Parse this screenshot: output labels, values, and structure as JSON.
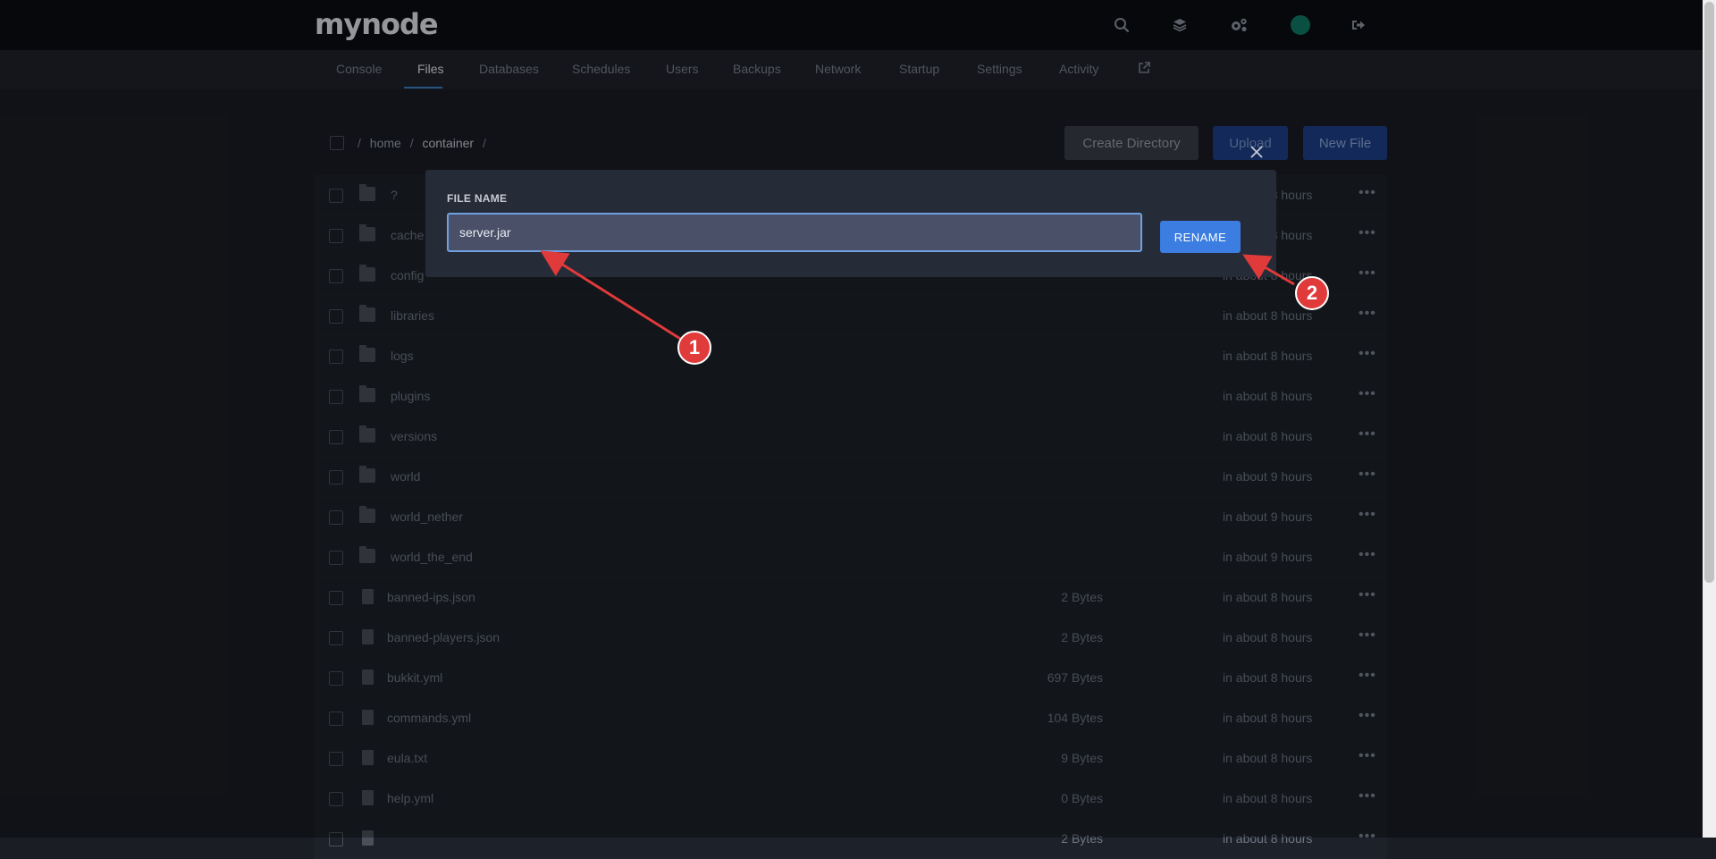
{
  "app": {
    "logo": "mynode"
  },
  "topbar": {
    "icons": [
      "search-icon",
      "layers-icon",
      "gears-icon",
      "avatar",
      "logout-icon"
    ]
  },
  "tabs": [
    "Console",
    "Files",
    "Databases",
    "Schedules",
    "Users",
    "Backups",
    "Network",
    "Startup",
    "Settings",
    "Activity"
  ],
  "active_tab": "Files",
  "breadcrumb": {
    "sep": "/",
    "parts": [
      "home",
      "container"
    ]
  },
  "actions": {
    "create_directory": "Create Directory",
    "upload": "Upload",
    "new_file": "New File"
  },
  "files": [
    {
      "type": "folder",
      "name": "?",
      "size": "",
      "date": "in about 8 hours"
    },
    {
      "type": "folder",
      "name": "cache",
      "size": "",
      "date": "in about 8 hours"
    },
    {
      "type": "folder",
      "name": "config",
      "size": "",
      "date": "in about 8 hours"
    },
    {
      "type": "folder",
      "name": "libraries",
      "size": "",
      "date": "in about 8 hours"
    },
    {
      "type": "folder",
      "name": "logs",
      "size": "",
      "date": "in about 8 hours"
    },
    {
      "type": "folder",
      "name": "plugins",
      "size": "",
      "date": "in about 8 hours"
    },
    {
      "type": "folder",
      "name": "versions",
      "size": "",
      "date": "in about 8 hours"
    },
    {
      "type": "folder",
      "name": "world",
      "size": "",
      "date": "in about 9 hours"
    },
    {
      "type": "folder",
      "name": "world_nether",
      "size": "",
      "date": "in about 9 hours"
    },
    {
      "type": "folder",
      "name": "world_the_end",
      "size": "",
      "date": "in about 9 hours"
    },
    {
      "type": "file",
      "name": "banned-ips.json",
      "size": "2 Bytes",
      "date": "in about 8 hours"
    },
    {
      "type": "file",
      "name": "banned-players.json",
      "size": "2 Bytes",
      "date": "in about 8 hours"
    },
    {
      "type": "file",
      "name": "bukkit.yml",
      "size": "697 Bytes",
      "date": "in about 8 hours"
    },
    {
      "type": "file",
      "name": "commands.yml",
      "size": "104 Bytes",
      "date": "in about 8 hours"
    },
    {
      "type": "file",
      "name": "eula.txt",
      "size": "9 Bytes",
      "date": "in about 8 hours"
    },
    {
      "type": "file",
      "name": "help.yml",
      "size": "0 Bytes",
      "date": "in about 8 hours"
    },
    {
      "type": "file",
      "name": "",
      "size": "2 Bytes",
      "date": "in about 8 hours"
    }
  ],
  "modal": {
    "label": "FILE NAME",
    "value": "server.jar",
    "button": "RENAME"
  },
  "annotations": {
    "badge1": "1",
    "badge2": "2",
    "color": "#e03a3a"
  }
}
